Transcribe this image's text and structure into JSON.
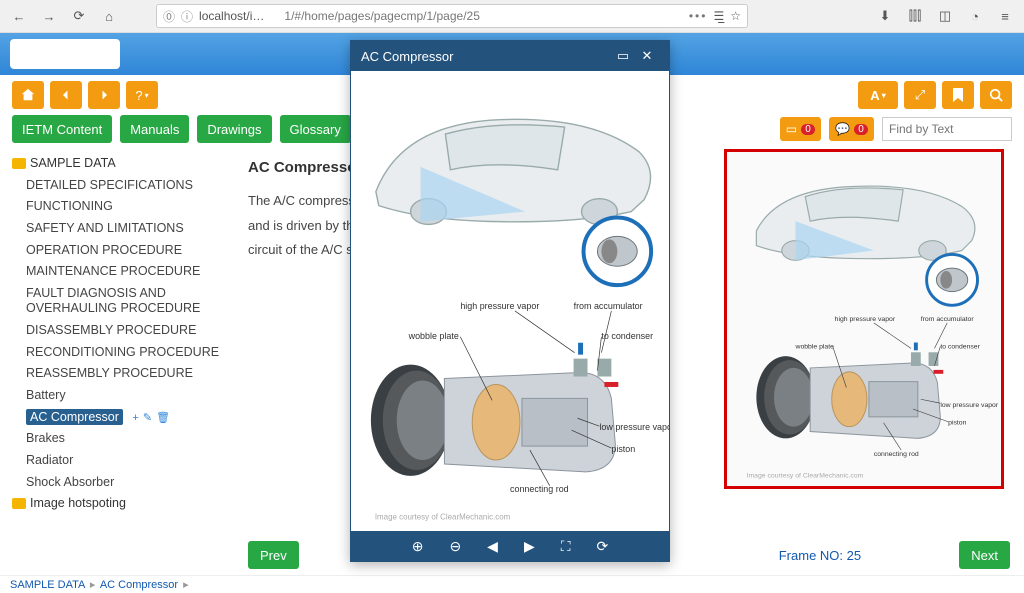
{
  "browser": {
    "url_host": "localhost/i…",
    "url_path": "1/#/home/pages/pagecmp/1/page/25"
  },
  "toolbar": {
    "home_icon": "home",
    "back_icon": "arrow-left",
    "forward_icon": "arrow-right",
    "help_icon": "question",
    "font_label": "A",
    "expand_icon": "expand",
    "bookmark_icon": "bookmark",
    "search_icon": "search"
  },
  "tabs": {
    "ietm_content": "IETM Content",
    "manuals": "Manuals",
    "drawings": "Drawings",
    "glossary": "Glossary"
  },
  "row2": {
    "annot_count": "0",
    "comment_count": "0",
    "find_placeholder": "Find by Text"
  },
  "sidebar": {
    "root": "SAMPLE DATA",
    "items": [
      "DETAILED SPECIFICATIONS",
      "FUNCTIONING",
      "SAFETY AND LIMITATIONS",
      "OPERATION PROCEDURE",
      "MAINTENANCE PROCEDURE",
      "FAULT DIAGNOSIS AND OVERHAULING PROCEDURE",
      "DISASSEMBLY PROCEDURE",
      "RECONDITIONING PROCEDURE",
      "REASSEMBLY PROCEDURE",
      "Battery",
      "AC Compressor",
      "Brakes",
      "Radiator",
      "Shock Absorber"
    ],
    "selected_index": 10,
    "root2": "Image hotspoting"
  },
  "content": {
    "title": "AC Compressor",
    "body": "The A/C compressor is the heart of the air conditioning system and is driven by the engine belt. It compresses the refrigerant circuit of the A/C system."
  },
  "diagram": {
    "labels": {
      "high_pressure": "high pressure vapor",
      "from_accumulator": "from accumulator",
      "wobble_plate": "wobble plate",
      "to_condenser": "to condenser",
      "low_pressure": "low pressure vapor",
      "piston": "piston",
      "connecting_rod": "connecting rod",
      "credit": "Image courtesy of ClearMechanic.com"
    }
  },
  "nav": {
    "prev": "Prev",
    "next": "Next",
    "frame_label": "Frame NO: 25"
  },
  "breadcrumb": {
    "a": "SAMPLE DATA",
    "b": "AC Compressor"
  },
  "modal": {
    "title": "AC Compressor"
  }
}
